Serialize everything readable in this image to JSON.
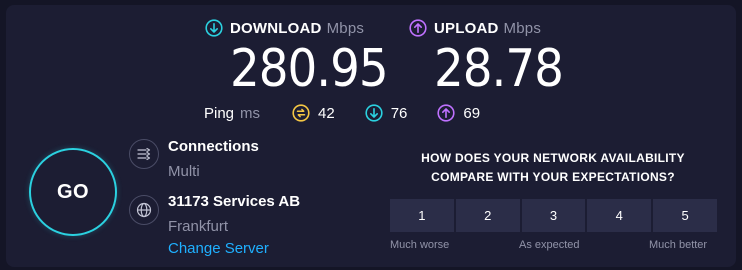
{
  "download": {
    "label": "DOWNLOAD",
    "unit": "Mbps",
    "value": "280.95",
    "icon": "arrow-down-circle-icon",
    "color": "#2bd1e0"
  },
  "upload": {
    "label": "UPLOAD",
    "unit": "Mbps",
    "value": "28.78",
    "icon": "arrow-up-circle-icon",
    "color": "#bf71ff"
  },
  "ping": {
    "label": "Ping",
    "unit": "ms",
    "idle": {
      "value": "42",
      "icon": "idle-latency-icon",
      "color": "#f5c744"
    },
    "down": {
      "value": "76",
      "icon": "arrow-down-circle-icon",
      "color": "#2bd1e0"
    },
    "up": {
      "value": "69",
      "icon": "arrow-up-circle-icon",
      "color": "#bf71ff"
    }
  },
  "go_label": "GO",
  "connections": {
    "title": "Connections",
    "value": "Multi",
    "icon": "connections-icon"
  },
  "server": {
    "title": "31173 Services AB",
    "location": "Frankfurt",
    "change_label": "Change Server",
    "icon": "globe-icon",
    "link_color": "#1fb0ff"
  },
  "survey": {
    "question_line1": "HOW DOES YOUR NETWORK AVAILABILITY",
    "question_line2": "COMPARE WITH YOUR EXPECTATIONS?",
    "options": [
      "1",
      "2",
      "3",
      "4",
      "5"
    ],
    "low_label": "Much worse",
    "mid_label": "As expected",
    "high_label": "Much better"
  }
}
